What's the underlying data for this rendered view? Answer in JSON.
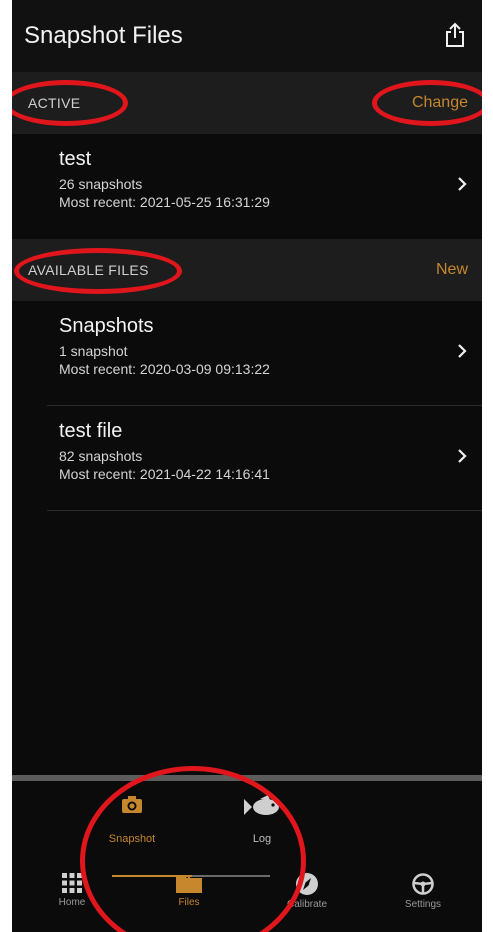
{
  "header": {
    "title": "Snapshot Files",
    "share_icon": "share-icon"
  },
  "active_section": {
    "title": "ACTIVE",
    "action": "Change",
    "rows": [
      {
        "name": "test",
        "count": "26 snapshots",
        "recent": "Most recent: 2021-05-25 16:31:29"
      }
    ]
  },
  "available_section": {
    "title": "AVAILABLE FILES",
    "action": "New",
    "rows": [
      {
        "name": "Snapshots",
        "count": "1 snapshot",
        "recent": "Most recent: 2020-03-09 09:13:22"
      },
      {
        "name": "test file",
        "count": "82 snapshots",
        "recent": "Most recent: 2021-04-22 14:16:41"
      }
    ]
  },
  "sub_tabs": {
    "snapshot": "Snapshot",
    "log": "Log"
  },
  "tab_bar": {
    "home": "Home",
    "files": "Files",
    "calibrate": "Calibrate",
    "settings": "Settings"
  },
  "colors": {
    "accent": "#c6872d",
    "background": "#0b0b0b",
    "section_bg": "#1d1d1d",
    "annotation": "#e0161c"
  }
}
